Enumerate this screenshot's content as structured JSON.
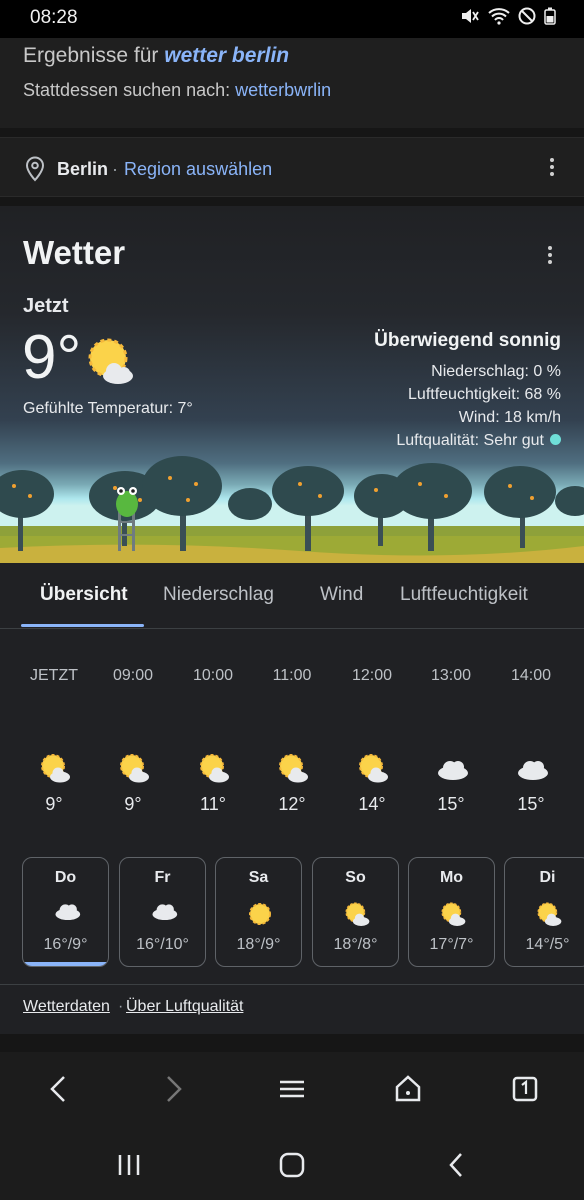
{
  "status_bar": {
    "time": "08:28"
  },
  "search": {
    "results_prefix": "Ergebnisse für",
    "results_query": "wetter berlin",
    "instead_prefix": "Stattdessen suchen nach:",
    "instead_query": "wetterbwrlin"
  },
  "location": {
    "city": "Berlin",
    "separator": "·",
    "region_link": "Region auswählen"
  },
  "weather": {
    "title": "Wetter",
    "now_label": "Jetzt",
    "current_temp": "9°",
    "felt": "Gefühlte Temperatur: 7°",
    "condition": "Überwiegend sonnig",
    "precipitation": "Niederschlag: 0 %",
    "humidity": "Luftfeuchtigkeit: 68 %",
    "wind": "Wind: 18 km/h",
    "air_quality": "Luftqualität: Sehr gut",
    "air_quality_color": "#6fdfd8",
    "tabs": [
      "Übersicht",
      "Niederschlag",
      "Wind",
      "Luftfeuchtigkeit"
    ],
    "hourly": [
      {
        "time": "JETZT",
        "icon": "partly-sunny-icon",
        "temp": "9°"
      },
      {
        "time": "09:00",
        "icon": "partly-sunny-icon",
        "temp": "9°"
      },
      {
        "time": "10:00",
        "icon": "partly-sunny-icon",
        "temp": "11°"
      },
      {
        "time": "11:00",
        "icon": "partly-sunny-icon",
        "temp": "12°"
      },
      {
        "time": "12:00",
        "icon": "partly-sunny-icon",
        "temp": "14°"
      },
      {
        "time": "13:00",
        "icon": "cloud-icon",
        "temp": "15°"
      },
      {
        "time": "14:00",
        "icon": "cloud-icon",
        "temp": "15°"
      }
    ],
    "daily": [
      {
        "day": "Do",
        "icon": "cloud-icon",
        "range": "16°/9°"
      },
      {
        "day": "Fr",
        "icon": "cloud-icon",
        "range": "16°/10°"
      },
      {
        "day": "Sa",
        "icon": "sun-icon",
        "range": "18°/9°"
      },
      {
        "day": "So",
        "icon": "partly-sunny-icon",
        "range": "18°/8°"
      },
      {
        "day": "Mo",
        "icon": "partly-sunny-icon",
        "range": "17°/7°"
      },
      {
        "day": "Di",
        "icon": "partly-sunny-icon",
        "range": "14°/5°"
      }
    ],
    "footer": {
      "data_link": "Wetterdaten",
      "sep": "·",
      "aq_link": "Über Luftqualität"
    }
  },
  "colors": {
    "accent": "#8ab4f8",
    "background": "#161616",
    "card": "#202124"
  }
}
